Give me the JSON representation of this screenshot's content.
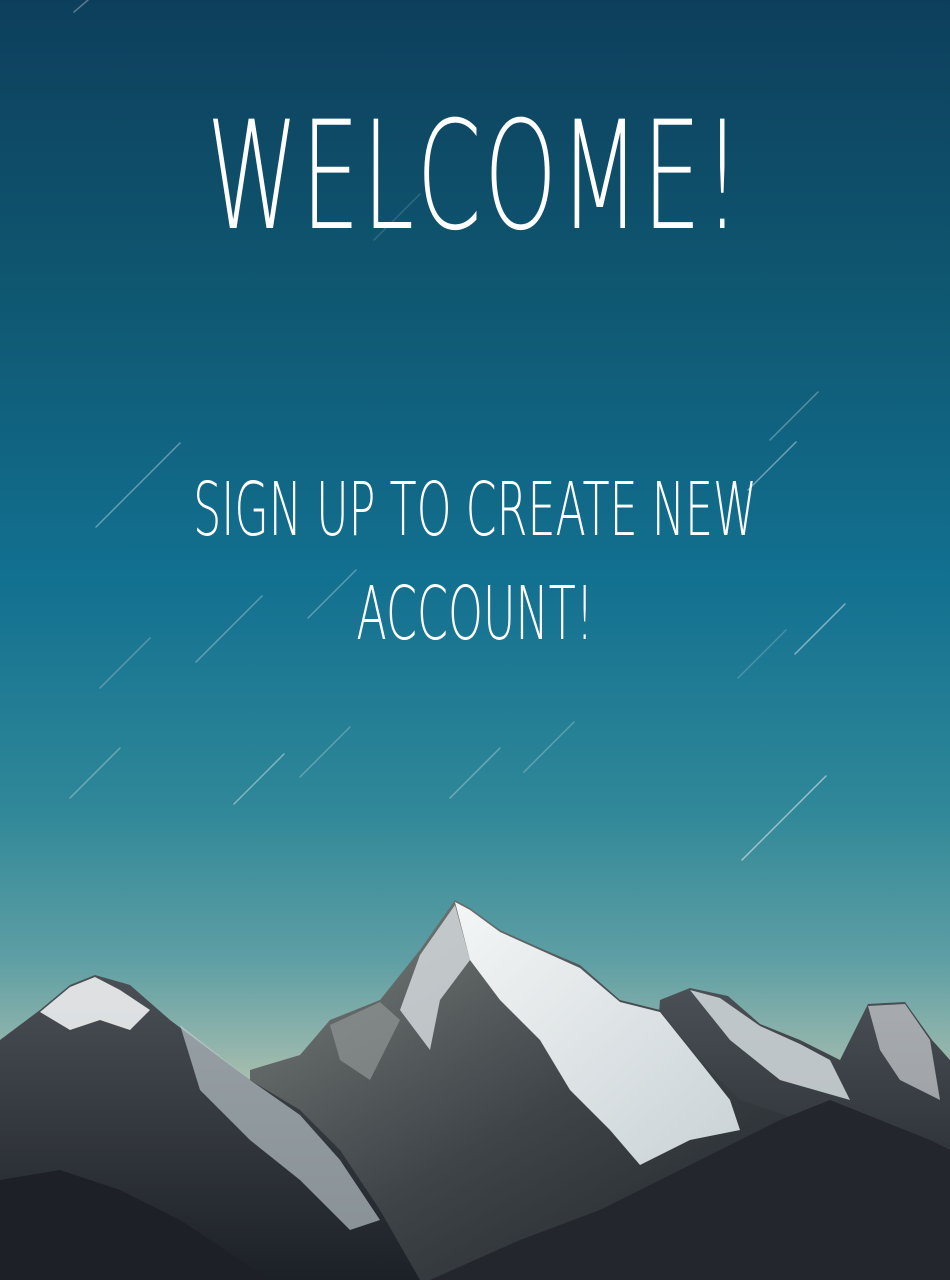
{
  "screen": {
    "title": "WELCOME!",
    "subtitle_line1": "SIGN UP TO CREATE NEW",
    "subtitle_line2": "ACCOUNT!"
  },
  "background": {
    "description_colors": {
      "sky_top": "#0d3f5c",
      "sky_mid": "#127090",
      "sky_horizon": "#b8c6b0",
      "text": "#ffffff"
    },
    "scene": "mountain-peaks"
  }
}
